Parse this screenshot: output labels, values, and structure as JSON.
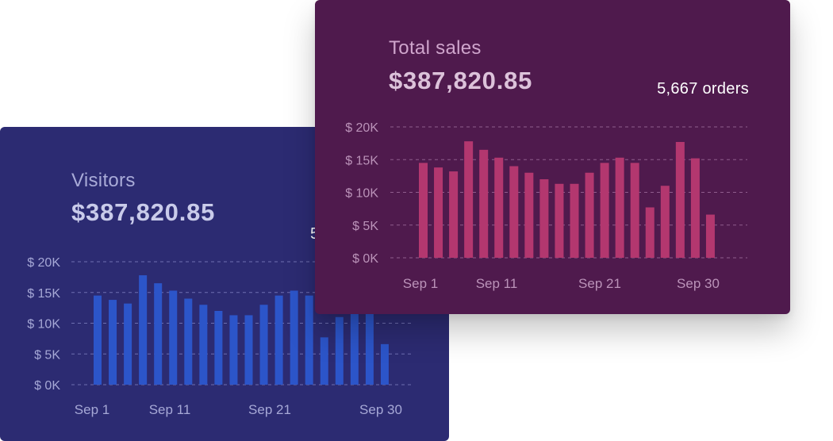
{
  "visitors_card": {
    "title": "Visitors",
    "amount": "$387,820.85",
    "orders_partial": "5",
    "bar_color": "#2c55c9",
    "grid_color": "#6e6fb0",
    "label_color": "#a6a8d6",
    "chart_data": {
      "type": "bar",
      "y_ticks": [
        "$ 0K",
        "$ 5K",
        "$ 10K",
        "$ 15K",
        "$ 20K"
      ],
      "x_ticks": [
        "Sep 1",
        "Sep 11",
        "Sep 21",
        "Sep 30"
      ],
      "ylim": [
        0,
        20000
      ],
      "values": [
        14500,
        13800,
        13200,
        17800,
        16500,
        15300,
        14000,
        13000,
        12000,
        11300,
        11300,
        13000,
        14500,
        15300,
        14500,
        7700,
        11000,
        17700,
        15200,
        6600
      ]
    }
  },
  "sales_card": {
    "title": "Total sales",
    "amount": "$387,820.85",
    "orders": "5,667 orders",
    "bar_color": "#b3376f",
    "grid_color": "#8f5d8d",
    "label_color": "#bb93b9",
    "chart_data": {
      "type": "bar",
      "y_ticks": [
        "$ 0K",
        "$ 5K",
        "$ 10K",
        "$ 15K",
        "$ 20K"
      ],
      "x_ticks": [
        "Sep 1",
        "Sep 11",
        "Sep 21",
        "Sep 30"
      ],
      "ylim": [
        0,
        20000
      ],
      "values": [
        14500,
        13800,
        13200,
        17800,
        16500,
        15300,
        14000,
        13000,
        12000,
        11300,
        11300,
        13000,
        14500,
        15300,
        14500,
        7700,
        11000,
        17700,
        15200,
        6600
      ]
    }
  }
}
